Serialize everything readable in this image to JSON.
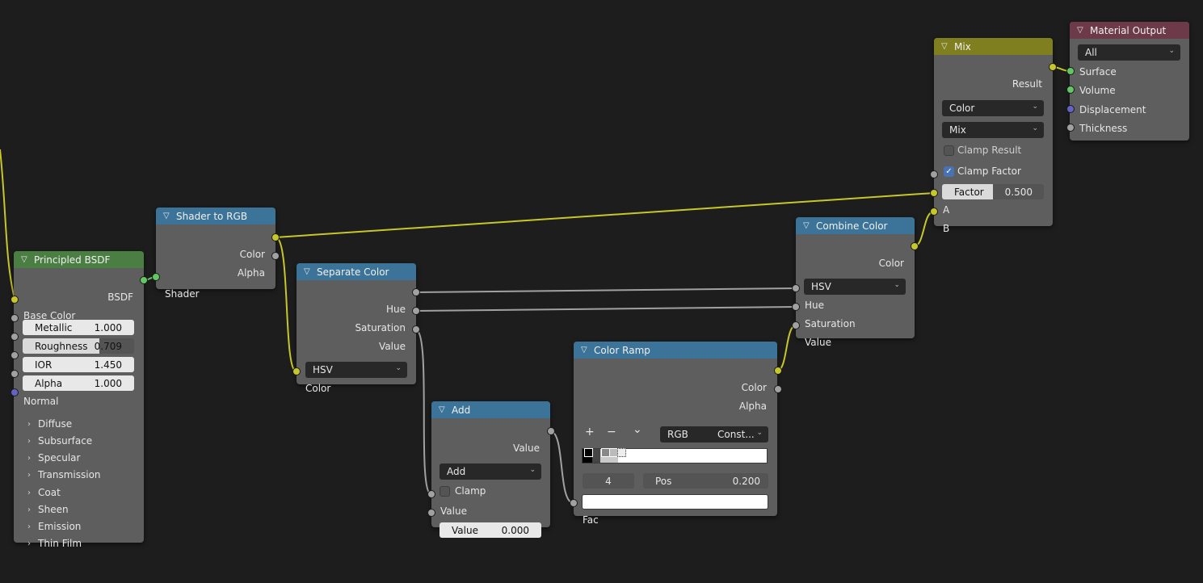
{
  "colors": {
    "background": "#1d1d1d",
    "node_body": "#5e5e5e",
    "header_input": "#4a7e43",
    "header_converter": "#3b7399",
    "header_mix": "#7f7f1f",
    "header_output": "#6c3a48",
    "wire_color": "#c7c729",
    "wire_float": "#a1a1a1"
  },
  "principled": {
    "title": "Principled BSDF",
    "bsdf": "BSDF",
    "base_color": "Base Color",
    "metallic": {
      "label": "Metallic",
      "value": "1.000"
    },
    "roughness": {
      "label": "Roughness",
      "value": "0.709",
      "fill": 0.709
    },
    "ior": {
      "label": "IOR",
      "value": "1.450"
    },
    "alpha": {
      "label": "Alpha",
      "value": "1.000"
    },
    "normal": "Normal",
    "panels": [
      "Diffuse",
      "Subsurface",
      "Specular",
      "Transmission",
      "Coat",
      "Sheen",
      "Emission",
      "Thin Film"
    ]
  },
  "shader_rgb": {
    "title": "Shader to RGB",
    "color": "Color",
    "alpha": "Alpha",
    "shader": "Shader"
  },
  "separate": {
    "title": "Separate Color",
    "hue": "Hue",
    "saturation": "Saturation",
    "value": "Value",
    "mode": "HSV",
    "color": "Color"
  },
  "add": {
    "title": "Add",
    "value_out": "Value",
    "operation": "Add",
    "clamp": "Clamp",
    "value_in": "Value",
    "value_field": {
      "label": "Value",
      "value": "0.000"
    }
  },
  "ramp": {
    "title": "Color Ramp",
    "color": "Color",
    "alpha": "Alpha",
    "add_icon": "+",
    "remove_icon": "−",
    "menu_icon": "⌄",
    "color_mode": "RGB",
    "interpolation": "Const...",
    "stop_index": "4",
    "pos": {
      "label": "Pos",
      "value": "0.200"
    },
    "fac": "Fac"
  },
  "combine": {
    "title": "Combine Color",
    "color": "Color",
    "mode": "HSV",
    "hue": "Hue",
    "saturation": "Saturation",
    "value": "Value"
  },
  "mix": {
    "title": "Mix",
    "result": "Result",
    "data_type": "Color",
    "blend": "Mix",
    "clamp_result": "Clamp Result",
    "clamp_factor": "Clamp Factor",
    "factor": {
      "label": "Factor",
      "value": "0.500",
      "fill": 0.5
    },
    "a": "A",
    "b": "B"
  },
  "output": {
    "title": "Material Output",
    "target": "All",
    "surface": "Surface",
    "volume": "Volume",
    "displacement": "Displacement",
    "thickness": "Thickness"
  }
}
